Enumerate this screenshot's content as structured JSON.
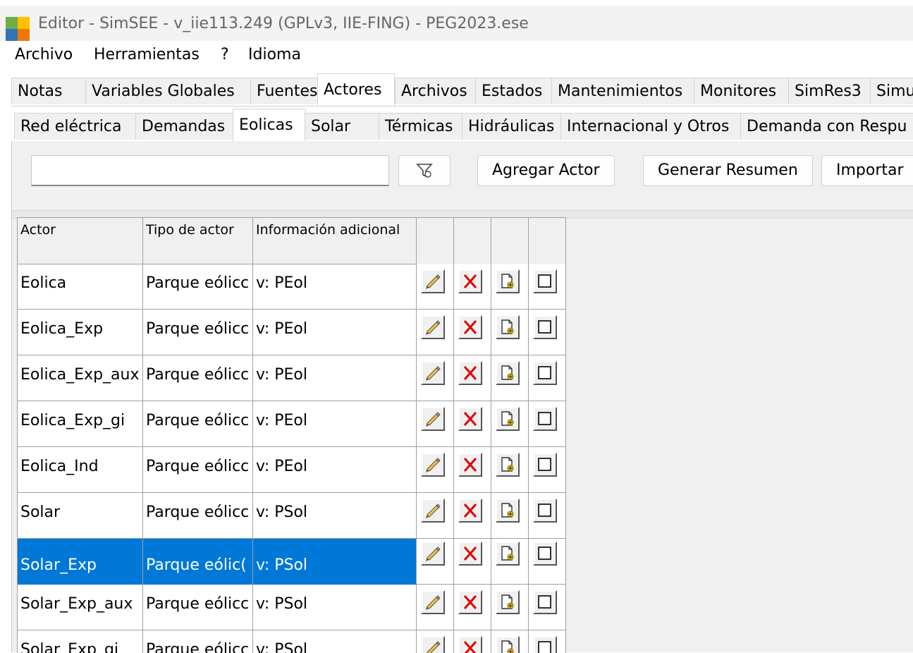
{
  "window": {
    "title": "Editor - SimSEE - v_iie113.249 (GPLv3, IIE-FING) - PEG2023.ese",
    "icon": "simsee-app-icon"
  },
  "menu": [
    "Archivo",
    "Herramientas",
    "?",
    "Idioma"
  ],
  "main_tabs": [
    "Notas",
    "Variables Globales",
    "Fuentes",
    "Actores",
    "Archivos",
    "Estados",
    "Mantenimientos",
    "Monitores",
    "SimRes3",
    "Simu"
  ],
  "main_tabs_active": "Actores",
  "sub_tabs": [
    "Red eléctrica",
    "Demandas",
    "Eolicas",
    "Solar",
    "Térmicas",
    "Hidráulicas",
    "Internacional y Otros",
    "Demanda con Respu"
  ],
  "sub_tabs_active": "Eolicas",
  "toolbar": {
    "filter_value": "",
    "filter_icon": "funnel-filter-icon",
    "buttons": [
      "Agregar Actor",
      "Generar Resumen",
      "Importar"
    ]
  },
  "grid": {
    "headers": [
      "Actor",
      "Tipo de actor",
      "Información adicional"
    ],
    "action_icons": [
      "edit-pencil-icon",
      "delete-x-icon",
      "clone-document-icon",
      "checkbox-icon"
    ],
    "rows": [
      {
        "actor": "Eolica",
        "tipo": "Parque eólicc",
        "info": "v: PEol"
      },
      {
        "actor": "Eolica_Exp",
        "tipo": "Parque eólicc",
        "info": "v: PEol"
      },
      {
        "actor": "Eolica_Exp_aux",
        "tipo": "Parque eólicc",
        "info": "v: PEol"
      },
      {
        "actor": "Eolica_Exp_gi",
        "tipo": "Parque eólicc",
        "info": "v: PEol"
      },
      {
        "actor": "Eolica_Ind",
        "tipo": "Parque eólicc",
        "info": "v: PEol"
      },
      {
        "actor": "Solar",
        "tipo": "Parque eólicc",
        "info": "v: PSol"
      },
      {
        "actor": "Solar_Exp",
        "tipo": "Parque eólic(",
        "info": "v: PSol",
        "selected": true
      },
      {
        "actor": "Solar_Exp_aux",
        "tipo": "Parque eólicc",
        "info": "v: PSol"
      },
      {
        "actor": "Solar_Exp_gi",
        "tipo": "Parque eólicc",
        "info": "v: PSol"
      }
    ]
  },
  "colors": {
    "selection": "#0078d7",
    "delete_icon": "#e00000",
    "logo_yellow": "#ffc000",
    "logo_orange": "#f07800",
    "logo_green": "#70ad47",
    "logo_blue": "#2e75b6"
  }
}
